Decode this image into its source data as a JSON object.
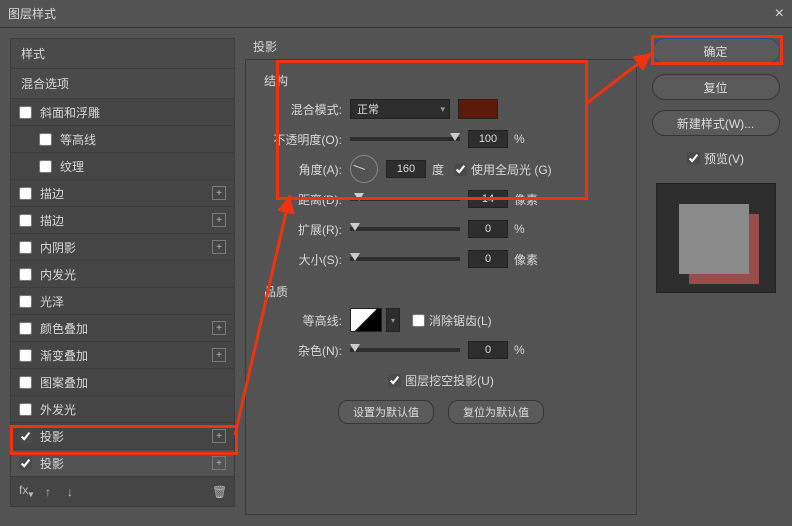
{
  "dialog": {
    "title": "图层样式"
  },
  "sidebar": {
    "header": "样式",
    "blend": "混合选项",
    "items": [
      {
        "label": "斜面和浮雕",
        "checked": false,
        "plus": false
      },
      {
        "label": "等高线",
        "checked": false,
        "plus": false,
        "indent": true
      },
      {
        "label": "纹理",
        "checked": false,
        "plus": false,
        "indent": true
      },
      {
        "label": "描边",
        "checked": false,
        "plus": true
      },
      {
        "label": "描边",
        "checked": false,
        "plus": true
      },
      {
        "label": "内阴影",
        "checked": false,
        "plus": true
      },
      {
        "label": "内发光",
        "checked": false,
        "plus": false
      },
      {
        "label": "光泽",
        "checked": false,
        "plus": false
      },
      {
        "label": "颜色叠加",
        "checked": false,
        "plus": true
      },
      {
        "label": "渐变叠加",
        "checked": false,
        "plus": true
      },
      {
        "label": "图案叠加",
        "checked": false,
        "plus": false
      },
      {
        "label": "外发光",
        "checked": false,
        "plus": false
      },
      {
        "label": "投影",
        "checked": true,
        "plus": true
      },
      {
        "label": "投影",
        "checked": true,
        "plus": true,
        "selected": true
      }
    ]
  },
  "center": {
    "title": "投影",
    "group_structure": "结构",
    "blend_mode_label": "混合模式:",
    "blend_mode_value": "正常",
    "opacity_label": "不透明度(O):",
    "opacity_value": "100",
    "opacity_unit": "%",
    "angle_label": "角度(A):",
    "angle_value": "160",
    "angle_unit": "度",
    "global_light_label": "使用全局光 (G)",
    "distance_label": "距离(D):",
    "distance_value": "14",
    "distance_unit": "像素",
    "spread_label": "扩展(R):",
    "spread_value": "0",
    "spread_unit": "%",
    "size_label": "大小(S):",
    "size_value": "0",
    "size_unit": "像素",
    "group_quality": "品质",
    "contour_label": "等高线:",
    "antialias_label": "消除锯齿(L)",
    "noise_label": "杂色(N):",
    "noise_value": "0",
    "noise_unit": "%",
    "knockout_label": "图层挖空投影(U)",
    "set_default": "设置为默认值",
    "reset_default": "复位为默认值"
  },
  "right": {
    "ok": "确定",
    "cancel": "复位",
    "new_style": "新建样式(W)...",
    "preview": "预览(V)"
  }
}
